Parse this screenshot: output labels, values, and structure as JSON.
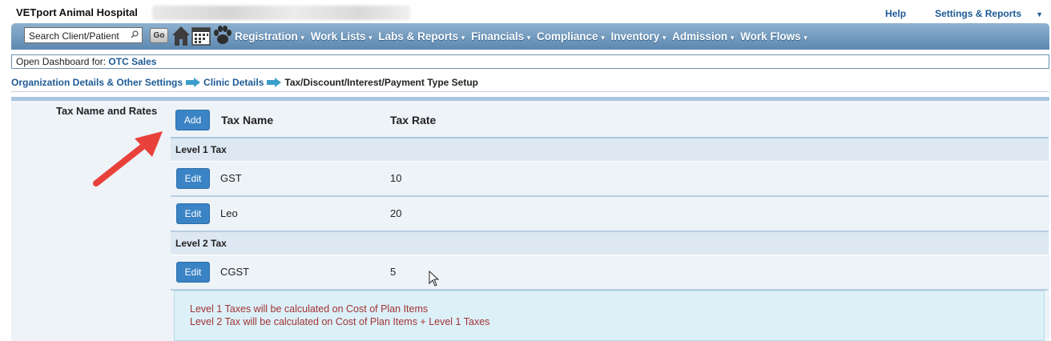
{
  "app": {
    "title": "VETport Animal Hospital",
    "help": "Help",
    "settings": "Settings & Reports"
  },
  "nav": {
    "search_placeholder": "Search Client/Patient",
    "go": "Go",
    "menu": [
      "Registration",
      "Work Lists",
      "Labs & Reports",
      "Financials",
      "Compliance",
      "Inventory",
      "Admission",
      "Work Flows"
    ]
  },
  "dashboard": {
    "label": "Open Dashboard for:",
    "link": "OTC Sales"
  },
  "breadcrumb": {
    "item1": "Organization Details & Other Settings",
    "item2": "Clinic Details",
    "current": "Tax/Discount/Interest/Payment Type Setup"
  },
  "section": {
    "label": "Tax Name and Rates",
    "add": "Add",
    "col_name": "Tax Name",
    "col_rate": "Tax Rate",
    "edit": "Edit",
    "groups": [
      {
        "title": "Level 1 Tax",
        "rows": [
          {
            "name": "GST",
            "rate": "10"
          },
          {
            "name": "Leo",
            "rate": "20"
          }
        ]
      },
      {
        "title": "Level 2 Tax",
        "rows": [
          {
            "name": "CGST",
            "rate": "5"
          }
        ]
      }
    ]
  },
  "notes": {
    "line1": "Level 1 Taxes will be calculated on Cost of Plan Items",
    "line2": "Level 2 Tax will be calculated on Cost of Plan Items + Level 1 Taxes"
  },
  "colors": {
    "accent": "#3a83c4",
    "link": "#1d5a96",
    "note_text": "#a23434",
    "annotation_arrow": "#e8413a"
  }
}
